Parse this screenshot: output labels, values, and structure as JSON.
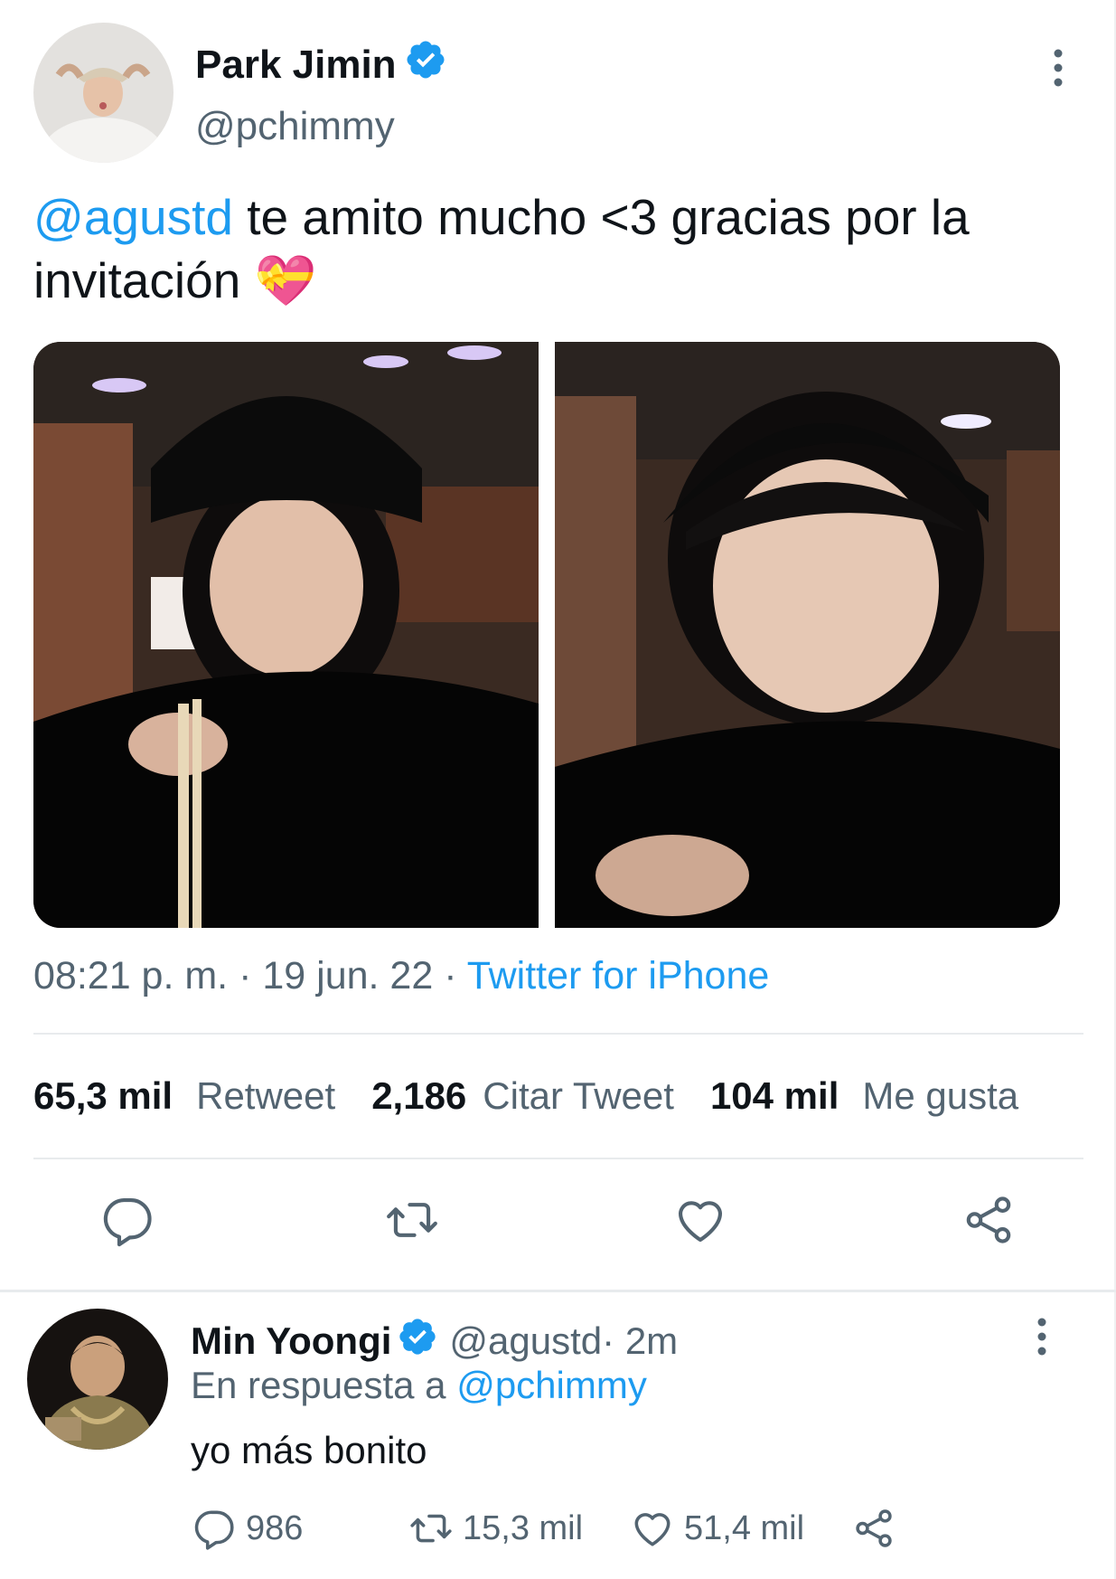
{
  "tweet": {
    "author": {
      "name": "Park Jimin",
      "handle": "@pchimmy",
      "verified": true
    },
    "text": {
      "mention": "@agustd",
      "body": " te amito mucho <3 gracias por la invitación ",
      "emoji": "💝"
    },
    "meta": {
      "time": "08:21 p. m.",
      "sep1": " · ",
      "date": "19 jun. 22",
      "sep2": " · ",
      "source": "Twitter for iPhone"
    },
    "stats": {
      "retweets": {
        "count": "65,3 mil",
        "label": "Retweet"
      },
      "quotes": {
        "count": "2,186",
        "label": "Citar Tweet"
      },
      "likes": {
        "count": "104 mil",
        "label": "Me gusta"
      }
    },
    "actions": [
      "reply-icon",
      "retweet-icon",
      "like-icon",
      "share-icon"
    ]
  },
  "reply": {
    "author": {
      "name": "Min Yoongi",
      "handle": "@agustd",
      "time": " · 2m",
      "verified": true
    },
    "in_reply_prefix": "En respuesta a ",
    "in_reply_handle": "@pchimmy",
    "text": "yo más bonito",
    "counts": {
      "replies": "986",
      "retweets": "15,3 mil",
      "likes": "51,4 mil"
    }
  },
  "colors": {
    "accent": "#1d9bf0",
    "text": "#0f1419",
    "secondary": "#536471",
    "divider": "#e8ebed"
  }
}
